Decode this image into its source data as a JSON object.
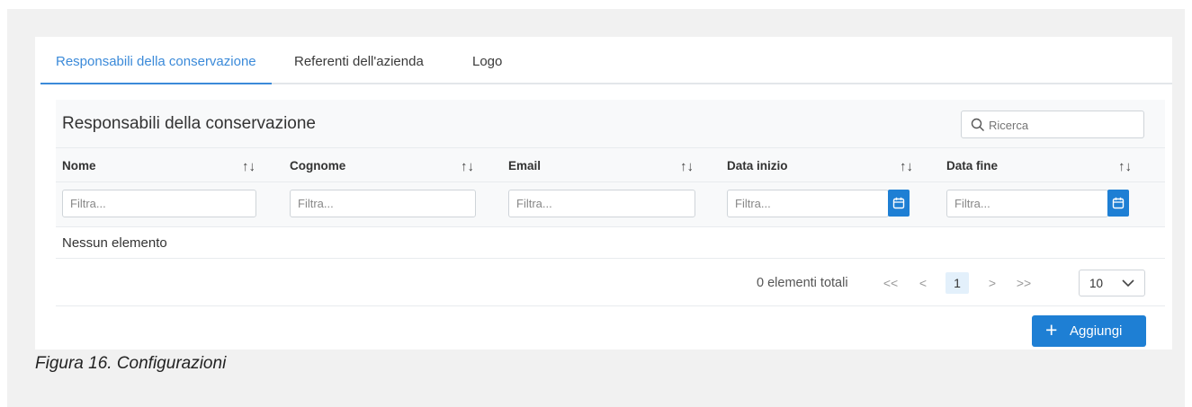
{
  "tabs": [
    {
      "label": "Responsabili della conservazione",
      "active": true
    },
    {
      "label": "Referenti dell'azienda",
      "active": false
    },
    {
      "label": "Logo",
      "active": false
    }
  ],
  "table": {
    "title": "Responsabili della conservazione",
    "search_placeholder": "Ricerca",
    "columns": [
      {
        "label": "Nome",
        "filter_placeholder": "Filtra...",
        "has_calendar": false
      },
      {
        "label": "Cognome",
        "filter_placeholder": "Filtra...",
        "has_calendar": false
      },
      {
        "label": "Email",
        "filter_placeholder": "Filtra...",
        "has_calendar": false
      },
      {
        "label": "Data inizio",
        "filter_placeholder": "Filtra...",
        "has_calendar": true
      },
      {
        "label": "Data fine",
        "filter_placeholder": "Filtra...",
        "has_calendar": true
      }
    ],
    "sort_icon": "↑↓",
    "empty_message": "Nessun elemento"
  },
  "pagination": {
    "total_text": "0 elementi totali",
    "first": "<<",
    "prev": "<",
    "current_page": "1",
    "next": ">",
    "last": ">>",
    "page_size": "10"
  },
  "actions": {
    "add_label": "Aggiungi",
    "add_icon": "+"
  },
  "caption": "Figura 16. Configurazioni",
  "colors": {
    "accent": "#3b8ad9",
    "primary_button": "#1e7fd4",
    "header_bg": "#f8f9fa",
    "frame_bg": "#f1f1f1"
  }
}
